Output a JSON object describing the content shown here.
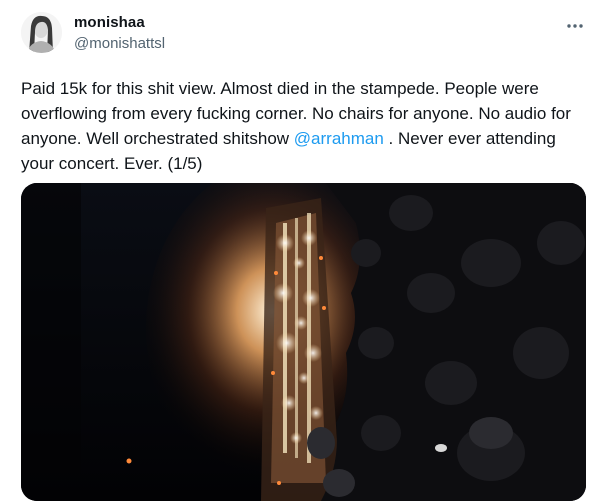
{
  "author": {
    "name": "monishaa",
    "handle": "@monishattsl"
  },
  "menu": {
    "icon": "more-horizontal-icon"
  },
  "tweet": {
    "text_before": "Paid 15k for this shit view. Almost died in the stampede. People were overflowing from every fucking corner. No chairs for anyone. No audio for anyone. Well orchestrated shitshow ",
    "mention": "@arrahman",
    "text_after": " . Never ever attending your concert. Ever. (1/5)"
  },
  "media": {
    "kind": "photo",
    "subject": "concert-stage-night"
  },
  "colors": {
    "accent": "#1d9bf0",
    "text": "#0f1419",
    "secondary_text": "#536471"
  }
}
